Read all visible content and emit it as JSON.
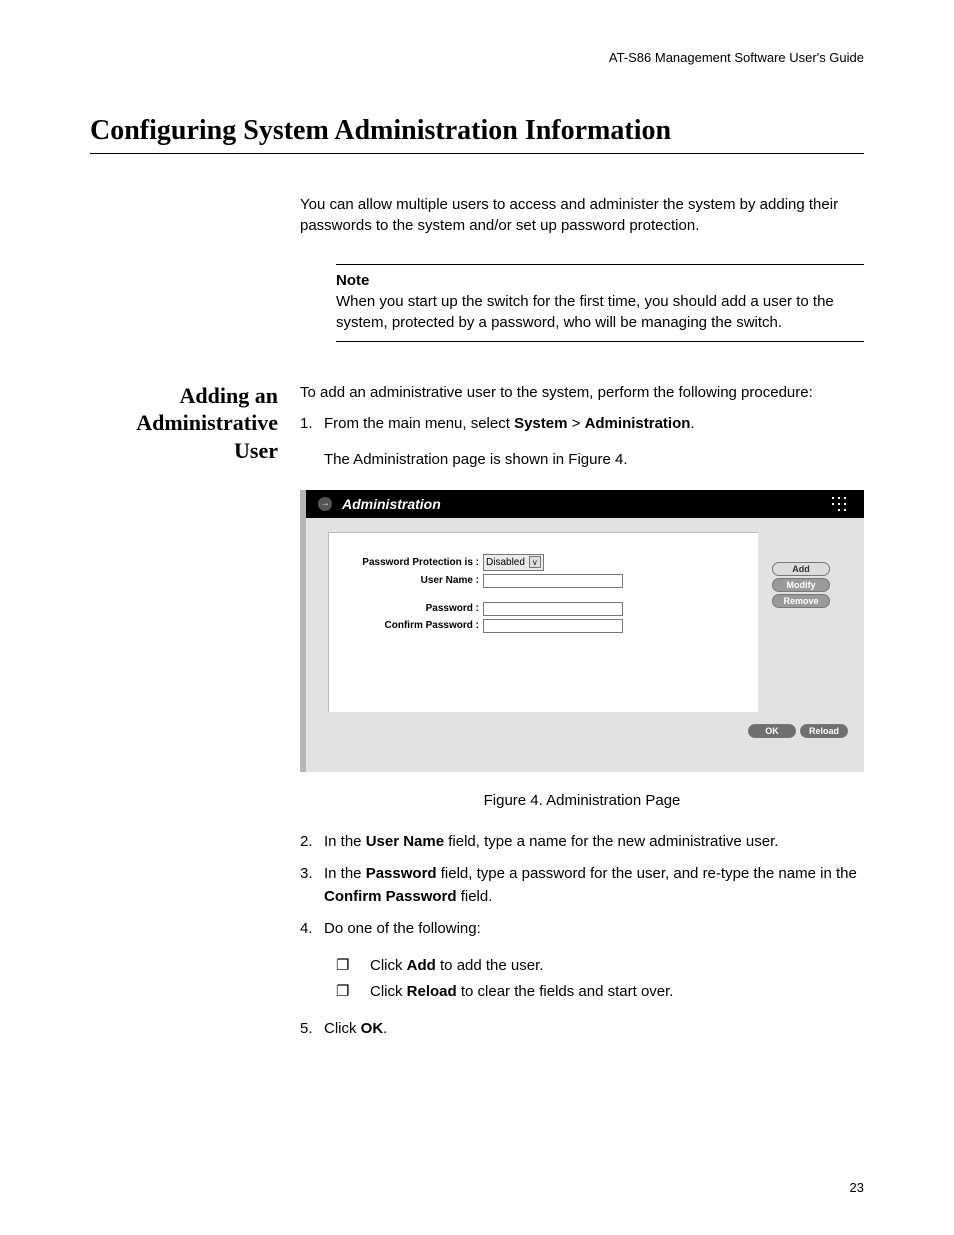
{
  "header": {
    "running": "AT-S86 Management Software User's Guide"
  },
  "title": "Configuring System Administration Information",
  "intro": "You can allow multiple users to access and administer the system by adding their passwords to the system and/or set up password protection.",
  "note": {
    "label": "Note",
    "text": "When you start up the switch for the first time, you should add a user to the system, protected by a password, who will be managing the switch."
  },
  "section": {
    "side_heading": "Adding an Administrative User",
    "lead": "To add an administrative user to the system, perform the following procedure:",
    "steps": {
      "s1_num": "1.",
      "s1_a": "From the main menu, select ",
      "s1_b": "System",
      "s1_c": " > ",
      "s1_d": "Administration",
      "s1_e": ".",
      "s1_follow": "The Administration page is shown in Figure 4.",
      "s2_num": "2.",
      "s2_a": "In the ",
      "s2_b": "User Name",
      "s2_c": " field, type a name for the new administrative user.",
      "s3_num": "3.",
      "s3_a": "In the ",
      "s3_b": "Password",
      "s3_c": " field, type a password for the user, and re-type the name in the ",
      "s3_d": "Confirm Password",
      "s3_e": " field.",
      "s4_num": "4.",
      "s4_text": "Do one of the following:",
      "s4_sub1_a": "Click ",
      "s4_sub1_b": "Add",
      "s4_sub1_c": " to add the user.",
      "s4_sub2_a": "Click ",
      "s4_sub2_b": "Reload",
      "s4_sub2_c": " to clear the fields and start over.",
      "s5_num": "5.",
      "s5_a": "Click ",
      "s5_b": "OK",
      "s5_c": "."
    }
  },
  "figure": {
    "title": "Administration",
    "caption": "Figure 4. Administration Page",
    "labels": {
      "pwd_protection": "Password Protection is :",
      "pwd_protection_value": "Disabled",
      "user_name": "User Name :",
      "password": "Password :",
      "confirm_password": "Confirm Password :"
    },
    "buttons": {
      "add": "Add",
      "modify": "Modify",
      "remove": "Remove",
      "ok": "OK",
      "reload": "Reload"
    }
  },
  "page_number": "23",
  "glyphs": {
    "bullet": "❐",
    "arrow": "→",
    "chev": "v"
  }
}
